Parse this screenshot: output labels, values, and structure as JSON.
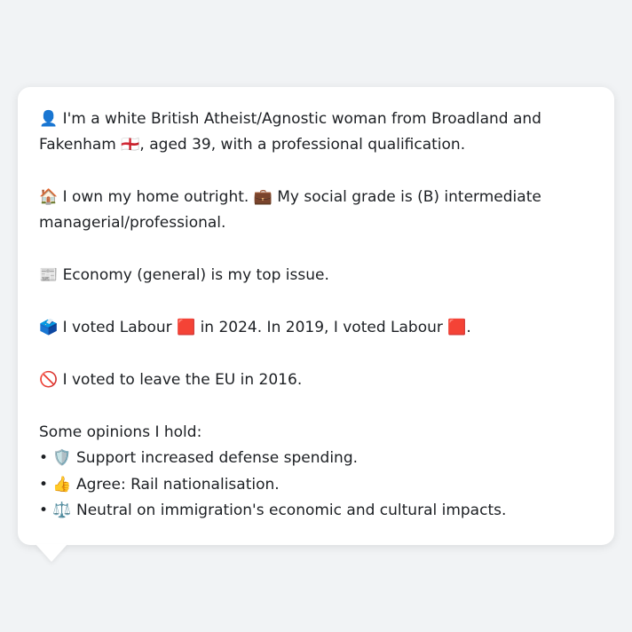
{
  "profile": {
    "line1": "👤 I'm a white British Atheist/Agnostic woman from Broadland and Fakenham 🏴󠁧󠁢󠁥󠁮󠁧󠁿, aged 39, with a professional qualification.",
    "line2": "🏠 I own my home outright. 💼 My social grade is (B) intermediate managerial/professional.",
    "line3": "📰 Economy (general) is my top issue.",
    "line4": "🗳️ I voted Labour 🟥 in 2024. In 2019, I voted Labour 🟥.",
    "line5": "🚫 I voted to leave the EU in 2016."
  },
  "opinions": {
    "title": "Some opinions I hold:",
    "items": [
      "• 🛡️ Support increased defense spending.",
      "• 👍 Agree: Rail nationalisation.",
      "• ⚖️ Neutral on immigration's economic and cultural impacts."
    ]
  }
}
